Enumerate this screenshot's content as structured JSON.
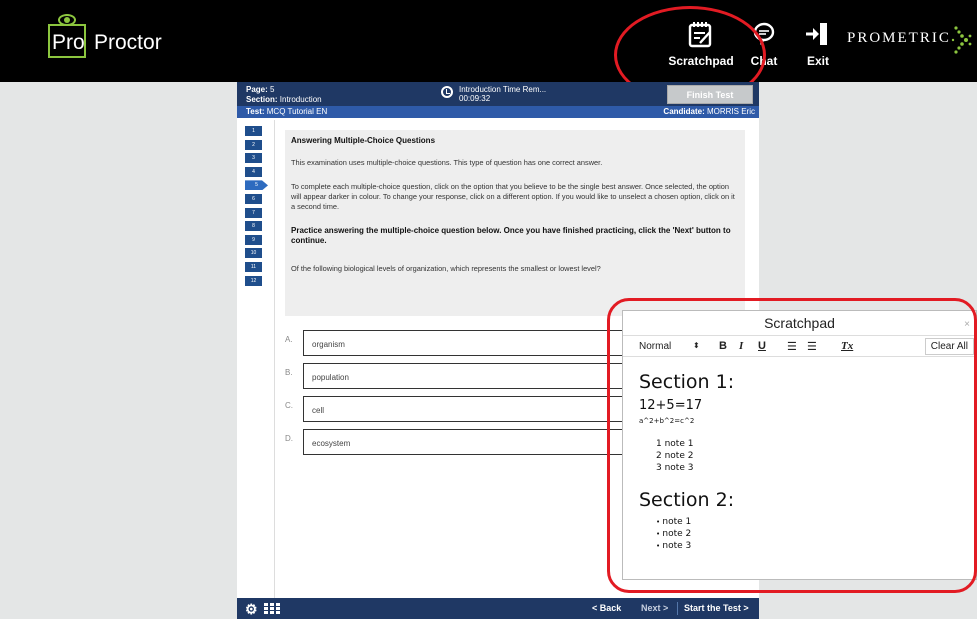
{
  "app": {
    "logo_pro": "Pro",
    "logo_proctor": "Proctor",
    "brand": "PROMETRIC"
  },
  "toolbar": {
    "scratchpad_label": "Scratchpad",
    "chat_label": "Chat",
    "exit_label": "Exit"
  },
  "exam": {
    "page_label": "Page:",
    "page_value": "5",
    "section_label": "Section:",
    "section_value": "Introduction",
    "timer_label": "Introduction Time Rem...",
    "timer_value": "00:09:32",
    "finish_label": "Finish Test",
    "test_label": "Test:",
    "test_value": "MCQ Tutorial EN",
    "candidate_label": "Candidate:",
    "candidate_value": "MORRIS Eric",
    "questions": [
      "1",
      "2",
      "3",
      "4",
      "5",
      "6",
      "7",
      "8",
      "9",
      "10",
      "11",
      "12"
    ],
    "current_question": "5"
  },
  "instructions": {
    "title": "Answering Multiple-Choice Questions",
    "p1": "This examination uses multiple-choice questions. This type of question has one correct answer.",
    "p2": "To complete each multiple-choice question, click on the option that you believe to be the single best answer. Once selected, the option will appear darker in colour. To change your response, click on a different option. If you would like to unselect a chosen option, click on it a second time.",
    "p3": "Practice answering the multiple-choice question below. Once you have finished practicing, click the 'Next' button to continue.",
    "question": "Of the following biological levels of organization, which represents the smallest or lowest level?"
  },
  "options": [
    {
      "letter": "A.",
      "text": "organism"
    },
    {
      "letter": "B.",
      "text": "population"
    },
    {
      "letter": "C.",
      "text": "cell"
    },
    {
      "letter": "D.",
      "text": "ecosystem"
    }
  ],
  "footer": {
    "back_label": "< Back",
    "next_label": "Next >",
    "start_label": "Start the Test >"
  },
  "scratchpad": {
    "title": "Scratchpad",
    "close": "×",
    "format": "Normal",
    "format_arrow": "⬍",
    "bold": "B",
    "italic": "I",
    "underline": "U",
    "ordered_list": "☰",
    "bullet_list": "☰",
    "clear_format": "Tx",
    "clear_all": "Clear All",
    "section1": "Section 1:",
    "equation1": "12+5=17",
    "equation2": "a^2+b^2=c^2",
    "numbered": [
      "1 note 1",
      "2 note 2",
      "3 note 3"
    ],
    "section2": "Section 2:",
    "bullets": [
      "note 1",
      "note 2",
      "note 3"
    ]
  },
  "colors": {
    "highlight": "#e21b23",
    "logo_green": "#8cc63f",
    "header_navy": "#1f3864",
    "header_blue": "#2e5aa8"
  }
}
